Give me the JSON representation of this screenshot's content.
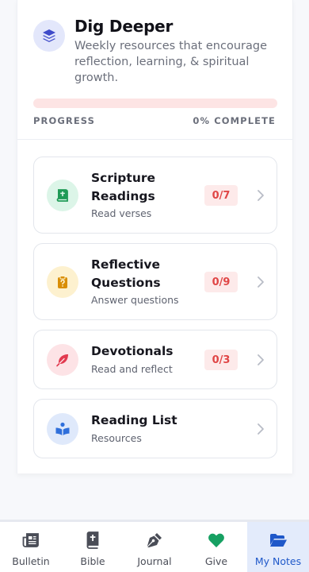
{
  "header": {
    "title": "Dig Deeper",
    "subtitle": "Weekly resources that encourage reflection, learning, & spiritual growth.",
    "icon": "layers-icon",
    "progress_label": "PROGRESS",
    "progress_value_text": "0% COMPLETE",
    "progress_fraction": 0
  },
  "items": [
    {
      "title": "Scripture Readings",
      "subtitle": "Read verses",
      "badge": "0/7",
      "icon": "bible-book-icon",
      "icon_bg": "#dcf5e8",
      "icon_color": "#1f9a56"
    },
    {
      "title": "Reflective Questions",
      "subtitle": "Answer questions",
      "badge": "0/9",
      "icon": "question-clipboard-icon",
      "icon_bg": "#fdf1cf",
      "icon_color": "#d98e06"
    },
    {
      "title": "Devotionals",
      "subtitle": "Read and reflect",
      "badge": "0/3",
      "icon": "feather-icon",
      "icon_bg": "#fde3e6",
      "icon_color": "#e23a4f"
    },
    {
      "title": "Reading List",
      "subtitle": "Resources",
      "badge": "",
      "icon": "open-book-reader-icon",
      "icon_bg": "#dfe9fb",
      "icon_color": "#2f6fdb"
    }
  ],
  "tabs": [
    {
      "label": "Bulletin",
      "icon": "newspaper-icon",
      "active": false
    },
    {
      "label": "Bible",
      "icon": "bible-icon",
      "active": false
    },
    {
      "label": "Journal",
      "icon": "pen-nib-icon",
      "active": false
    },
    {
      "label": "Give",
      "icon": "heart-icon",
      "active": false
    },
    {
      "label": "My Notes",
      "icon": "folder-open-icon",
      "active": true
    }
  ],
  "colors": {
    "accent": "#1f58c9",
    "progress_track": "#fde4e4",
    "badge_text": "#e04646",
    "give_heart": "#16a062"
  }
}
